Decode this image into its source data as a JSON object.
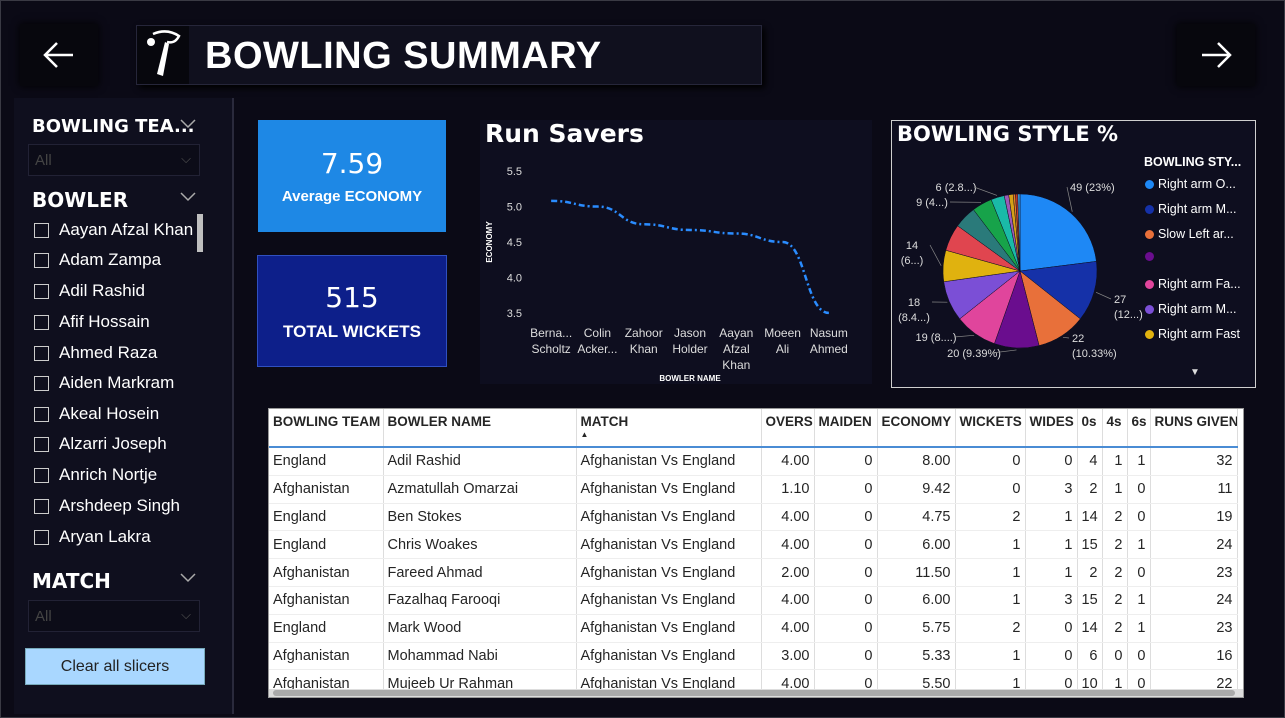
{
  "header": {
    "title": "BOWLING SUMMARY"
  },
  "kpis": {
    "avg_economy_value": "7.59",
    "avg_economy_label": "Average ECONOMY",
    "total_wickets_value": "515",
    "total_wickets_label": "TOTAL WICKETS"
  },
  "sidebar": {
    "team_heading": "BOWLING TEA...",
    "team_selected": "All",
    "bowler_heading": "BOWLER",
    "bowlers": [
      "Aayan Afzal Khan",
      "Adam Zampa",
      "Adil Rashid",
      "Afif Hossain",
      "Ahmed Raza",
      "Aiden Markram",
      "Akeal Hosein",
      "Alzarri Joseph",
      "Anrich Nortje",
      "Arshdeep Singh",
      "Aryan Lakra"
    ],
    "match_heading": "MATCH",
    "match_selected": "All",
    "clear_label": "Clear all slicers"
  },
  "colors": {
    "accent_blue": "#1e88e5",
    "dark_blue": "#0d1f8a",
    "line": "#2a8cff"
  },
  "chart_data": [
    {
      "type": "line",
      "title": "Run Savers",
      "xlabel": "BOWLER NAME",
      "ylabel": "ECONOMY",
      "categories": [
        "Berna... Scholtz",
        "Colin Acker...",
        "Zahoor Khan",
        "Jason Holder",
        "Aayan Afzal Khan",
        "Moeen Ali",
        "Nasum Ahmed"
      ],
      "values": [
        5.08,
        5.0,
        4.75,
        4.67,
        4.62,
        4.5,
        3.5
      ],
      "y_ticks": [
        3.5,
        4.0,
        4.5,
        5.0,
        5.5
      ],
      "ylim": [
        3.4,
        5.6
      ]
    },
    {
      "type": "pie",
      "title": "BOWLING STYLE %",
      "legend_title": "BOWLING STY...",
      "legend": [
        {
          "label": "Right arm O...",
          "color": "#1e88f5"
        },
        {
          "label": "Right arm M...",
          "color": "#1531a8"
        },
        {
          "label": "Slow Left ar...",
          "color": "#e8703a"
        },
        {
          "label": "",
          "color": "#6a0d8e"
        },
        {
          "label": "Right arm Fa...",
          "color": "#e0459c"
        },
        {
          "label": "Right arm M...",
          "color": "#7b4fd6"
        },
        {
          "label": "Right arm Fast",
          "color": "#e0b20f"
        }
      ],
      "slices": [
        {
          "value": 49,
          "label": "49 (23%)",
          "color": "#1e88f5"
        },
        {
          "value": 27,
          "label": "27 (12...)",
          "color": "#1531a8"
        },
        {
          "value": 22,
          "label": "22 (10.33%)",
          "color": "#e8703a"
        },
        {
          "value": 20,
          "label": "20 (9.39%)",
          "color": "#6a0d8e"
        },
        {
          "value": 19,
          "label": "19 (8....)",
          "color": "#e0459c"
        },
        {
          "value": 18,
          "label": "18 (8.4...)",
          "color": "#7b4fd6"
        },
        {
          "value": 14,
          "label": "14 (6...)",
          "color": "#e0b20f"
        },
        {
          "value": 12,
          "label": "",
          "color": "#e0454f"
        },
        {
          "value": 10,
          "label": "",
          "color": "#2a7a7a"
        },
        {
          "value": 9,
          "label": "9 (4...)",
          "color": "#17a34a"
        },
        {
          "value": 6,
          "label": "6 (2.8...)",
          "color": "#1abaa8"
        },
        {
          "value": 2,
          "label": "",
          "color": "#9b59b6"
        },
        {
          "value": 2,
          "label": "",
          "color": "#d4a017"
        },
        {
          "value": 1,
          "label": "",
          "color": "#e67e22"
        },
        {
          "value": 1,
          "label": "",
          "color": "#c0392b"
        },
        {
          "value": 1,
          "label": "",
          "color": "#3498db"
        }
      ]
    }
  ],
  "table": {
    "columns": [
      "BOWLING TEAM",
      "BOWLER NAME",
      "MATCH",
      "OVERS",
      "MAIDEN",
      "ECONOMY",
      "WICKETS",
      "WIDES",
      "0s",
      "4s",
      "6s",
      "RUNS GIVEN"
    ],
    "rows": [
      [
        "England",
        "Adil Rashid",
        "Afghanistan Vs England",
        "4.00",
        "0",
        "8.00",
        "0",
        "0",
        "4",
        "1",
        "1",
        "32"
      ],
      [
        "Afghanistan",
        "Azmatullah Omarzai",
        "Afghanistan Vs England",
        "1.10",
        "0",
        "9.42",
        "0",
        "3",
        "2",
        "1",
        "0",
        "11"
      ],
      [
        "England",
        "Ben Stokes",
        "Afghanistan Vs England",
        "4.00",
        "0",
        "4.75",
        "2",
        "1",
        "14",
        "2",
        "0",
        "19"
      ],
      [
        "England",
        "Chris Woakes",
        "Afghanistan Vs England",
        "4.00",
        "0",
        "6.00",
        "1",
        "1",
        "15",
        "2",
        "1",
        "24"
      ],
      [
        "Afghanistan",
        "Fareed Ahmad",
        "Afghanistan Vs England",
        "2.00",
        "0",
        "11.50",
        "1",
        "1",
        "2",
        "2",
        "0",
        "23"
      ],
      [
        "Afghanistan",
        "Fazalhaq Farooqi",
        "Afghanistan Vs England",
        "4.00",
        "0",
        "6.00",
        "1",
        "3",
        "15",
        "2",
        "1",
        "24"
      ],
      [
        "England",
        "Mark Wood",
        "Afghanistan Vs England",
        "4.00",
        "0",
        "5.75",
        "2",
        "0",
        "14",
        "2",
        "1",
        "23"
      ],
      [
        "Afghanistan",
        "Mohammad Nabi",
        "Afghanistan Vs England",
        "3.00",
        "0",
        "5.33",
        "1",
        "0",
        "6",
        "0",
        "0",
        "16"
      ],
      [
        "Afghanistan",
        "Mujeeb Ur Rahman",
        "Afghanistan Vs England",
        "4.00",
        "0",
        "5.50",
        "1",
        "0",
        "10",
        "1",
        "0",
        "22"
      ]
    ]
  }
}
